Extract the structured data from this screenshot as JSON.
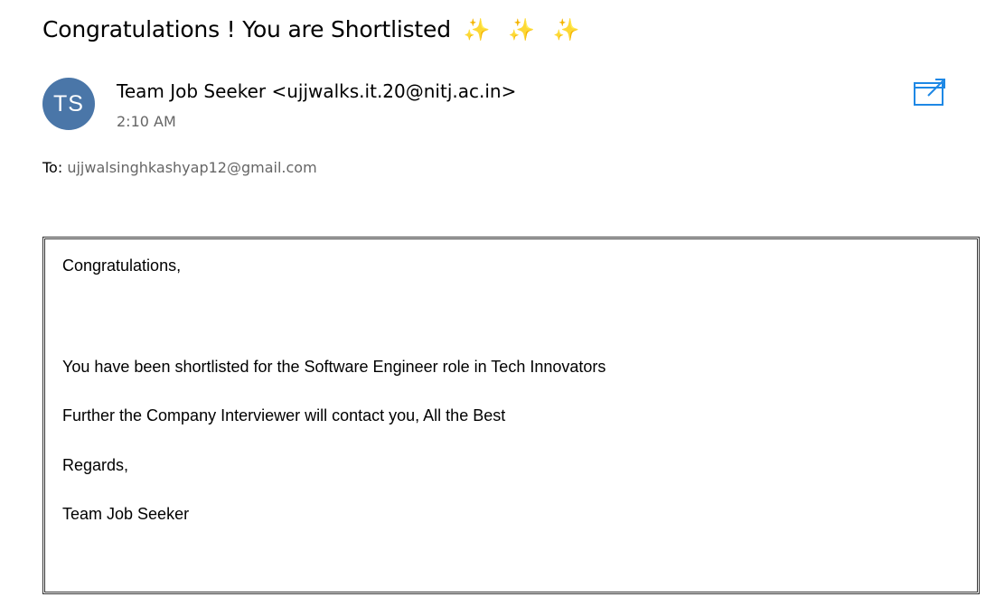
{
  "email": {
    "subject": "Congratulations ! You are Shortlisted",
    "subject_sparkles": "✨ ✨ ✨",
    "sender": {
      "initials": "TS",
      "display": "Team Job Seeker <ujjwalks.it.20@nitj.ac.in>",
      "avatar_color": "#4a76a8"
    },
    "time": "2:10 AM",
    "to_label": "To:",
    "to_address": "ujjwalsinghkashyap12@gmail.com",
    "popout_icon": "open-in-new-window-icon",
    "accent_color": "#1e88e5",
    "body": {
      "greeting": "Congratulations,",
      "line1": "You have been shortlisted for the Software Engineer role in Tech Innovators",
      "line2": "Further the Company Interviewer will contact you, All the Best",
      "closing": "Regards,",
      "signature": "Team Job Seeker"
    }
  }
}
